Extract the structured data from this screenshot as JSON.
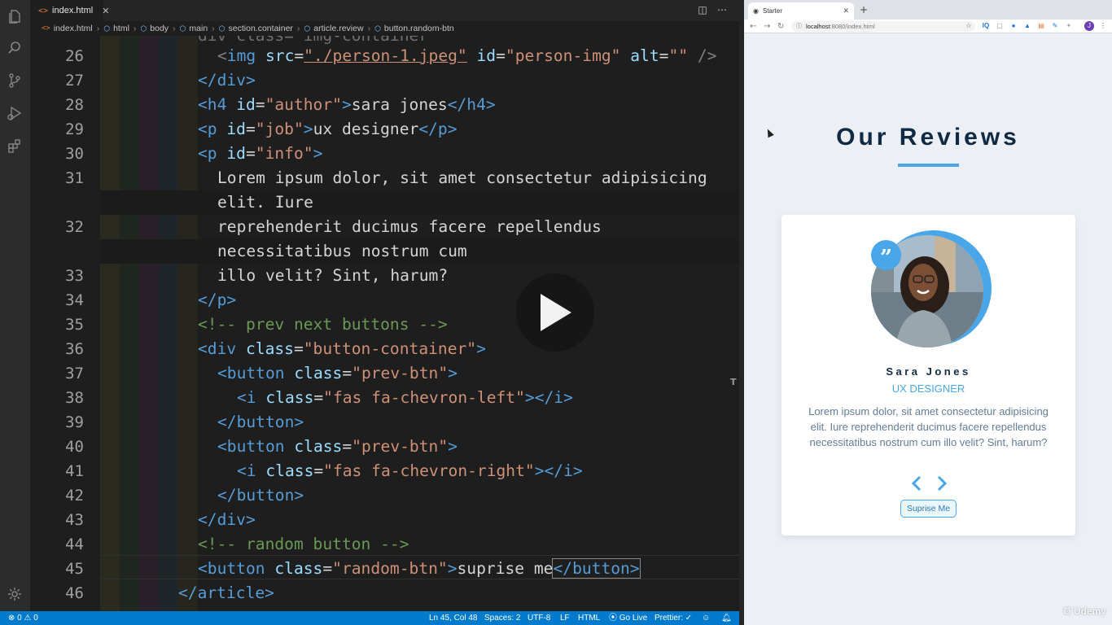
{
  "editor": {
    "tab_label": "index.html",
    "tab_icon": "html-file-icon",
    "breadcrumbs": [
      "index.html",
      "html",
      "body",
      "main",
      "section.container",
      "article.review",
      "button.random-btn"
    ],
    "line_numbers": [
      "26",
      "27",
      "28",
      "29",
      "30",
      "31",
      "",
      "32",
      "",
      "33",
      "34",
      "35",
      "36",
      "37",
      "38",
      "39",
      "40",
      "41",
      "42",
      "43",
      "44",
      "45",
      "46"
    ],
    "top_partial_line": "div class=\"img-container\"",
    "colors": {
      "tag": "#569cd6",
      "attr": "#9cdcfe",
      "string": "#ce9178",
      "comment": "#6a9955",
      "text": "#d4d4d4"
    }
  },
  "code": {
    "l26": {
      "lt": "<",
      "tag": "img",
      "a1": " src",
      "eq1": "=",
      "s1": "\"./person-1.jpeg\"",
      "a2": " id",
      "eq2": "=",
      "s2": "\"person-img\"",
      "a3": " alt",
      "eq3": "=",
      "s3": "\"\"",
      "end": " />"
    },
    "l27": {
      "close": "</div>"
    },
    "l28": {
      "tag": "<h4",
      "a1": " id",
      "eq": "=",
      "s1": "\"author\"",
      "gt": ">",
      "text": "sara jones",
      "close": "</h4>"
    },
    "l29": {
      "tag": "<p",
      "a1": " id",
      "eq": "=",
      "s1": "\"job\"",
      "gt": ">",
      "text": "ux designer",
      "close": "</p>"
    },
    "l30": {
      "tag": "<p",
      "a1": " id",
      "eq": "=",
      "s1": "\"info\"",
      "gt": ">"
    },
    "l31a": "Lorem ipsum dolor, sit amet consectetur adipisicing",
    "l31b": "elit. Iure",
    "l32a": "reprehenderit ducimus facere repellendus",
    "l32b": "necessitatibus nostrum cum",
    "l33": "illo velit? Sint, harum?",
    "l34": {
      "close": "</p>"
    },
    "l35": "<!-- prev next buttons -->",
    "l36": {
      "tag": "<div",
      "a1": " class",
      "eq": "=",
      "s1": "\"button-container\"",
      "gt": ">"
    },
    "l37": {
      "tag": "<button",
      "a1": " class",
      "eq": "=",
      "s1": "\"prev-btn\"",
      "gt": ">"
    },
    "l38": {
      "tag": "<i",
      "a1": " class",
      "eq": "=",
      "s1": "\"fas fa-chevron-left\"",
      "gt": ">",
      "close": "</i>"
    },
    "l39": {
      "close": "</button>"
    },
    "l40": {
      "tag": "<button",
      "a1": " class",
      "eq": "=",
      "s1": "\"prev-btn\"",
      "gt": ">"
    },
    "l41": {
      "tag": "<i",
      "a1": " class",
      "eq": "=",
      "s1": "\"fas fa-chevron-right\"",
      "gt": ">",
      "close": "</i>"
    },
    "l42": {
      "close": "</button>"
    },
    "l43": {
      "close": "</div>"
    },
    "l44": "<!-- random button -->",
    "l45": {
      "tag": "<button",
      "a1": " class",
      "eq": "=",
      "s1": "\"random-btn\"",
      "gt": ">",
      "text": "suprise me",
      "close": "</button>"
    },
    "l46": {
      "close": "</article>"
    }
  },
  "statusbar": {
    "errors": "0",
    "warnings": "0",
    "position": "Ln 45, Col 48",
    "spaces": "Spaces: 2",
    "encoding": "UTF-8",
    "eol": "LF",
    "language": "HTML",
    "golive": "Go Live",
    "prettier": "Prettier: ✓"
  },
  "browser": {
    "tab_title": "Starter",
    "url_host": "localhost",
    "url_rest": ":8080/index.html",
    "profile_initial": "J"
  },
  "page": {
    "heading": "Our Reviews",
    "author": "Sara Jones",
    "job": "UX DESIGNER",
    "info": "Lorem ipsum dolor, sit amet consectetur adipisicing elit. Iure reprehenderit ducimus facere repellendus necessitatibus nostrum cum illo velit? Sint, harum?",
    "random_button": "Suprise Me",
    "accent_color": "#49a6e9",
    "heading_color": "#102a43"
  },
  "watermark": "Udemy"
}
